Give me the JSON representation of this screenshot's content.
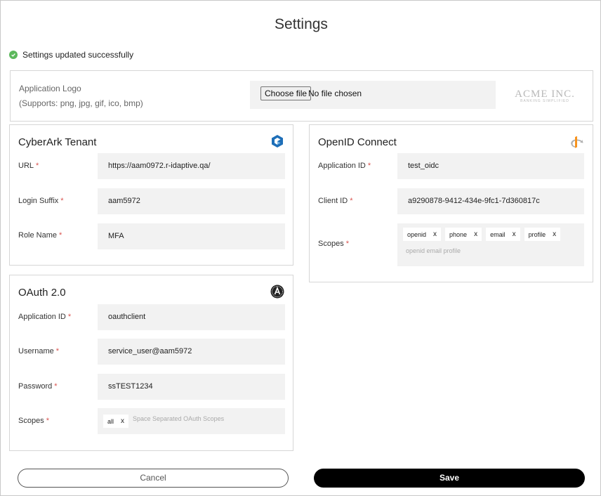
{
  "dialog": {
    "title": "Settings"
  },
  "toast": {
    "message": "Settings updated successfully",
    "color": "#5cb85c"
  },
  "logo_section": {
    "label": "Application Logo",
    "supports": "(Supports: png, jpg, gif, ico, bmp)",
    "choose_button": "Choose file",
    "file_status": "No file chosen",
    "brand_name": "ACME INC.",
    "brand_tagline": "BANKING SIMPLIFIED"
  },
  "cyberark": {
    "title": "CyberArk Tenant",
    "icon": "cyberark-logo-icon",
    "fields": {
      "url": {
        "label": "URL",
        "value": "https://aam0972.r-idaptive.qa/"
      },
      "login_suffix": {
        "label": "Login Suffix",
        "value": "aam5972"
      },
      "role_name": {
        "label": "Role Name",
        "value": "MFA"
      }
    },
    "required_mark": "*"
  },
  "oauth": {
    "title": "OAuth 2.0",
    "icon": "oauth-logo-icon",
    "fields": {
      "app_id": {
        "label": "Application ID",
        "value": "oauthclient"
      },
      "username": {
        "label": "Username",
        "value": "service_user@aam5972"
      },
      "password": {
        "label": "Password",
        "value": "ssTEST1234"
      },
      "scopes": {
        "label": "Scopes",
        "chips": [
          "all"
        ],
        "placeholder": "Space Separated OAuth Scopes"
      }
    }
  },
  "oidc": {
    "title": "OpenID Connect",
    "icon": "openid-logo-icon",
    "fields": {
      "app_id": {
        "label": "Application ID",
        "value": "test_oidc"
      },
      "client_id": {
        "label": "Client ID",
        "value": "a9290878-9412-434e-9fc1-7d360817c"
      },
      "scopes": {
        "label": "Scopes",
        "chips": [
          "openid",
          "phone",
          "email",
          "profile"
        ],
        "placeholder": "openid email profile"
      }
    }
  },
  "chip_remove": "x",
  "footer": {
    "cancel_label": "Cancel",
    "save_label": "Save"
  },
  "colors": {
    "accent": "#000000",
    "required": "#d9534f",
    "cyberark_blue": "#1e6fb8",
    "openid_orange": "#f7931e"
  }
}
